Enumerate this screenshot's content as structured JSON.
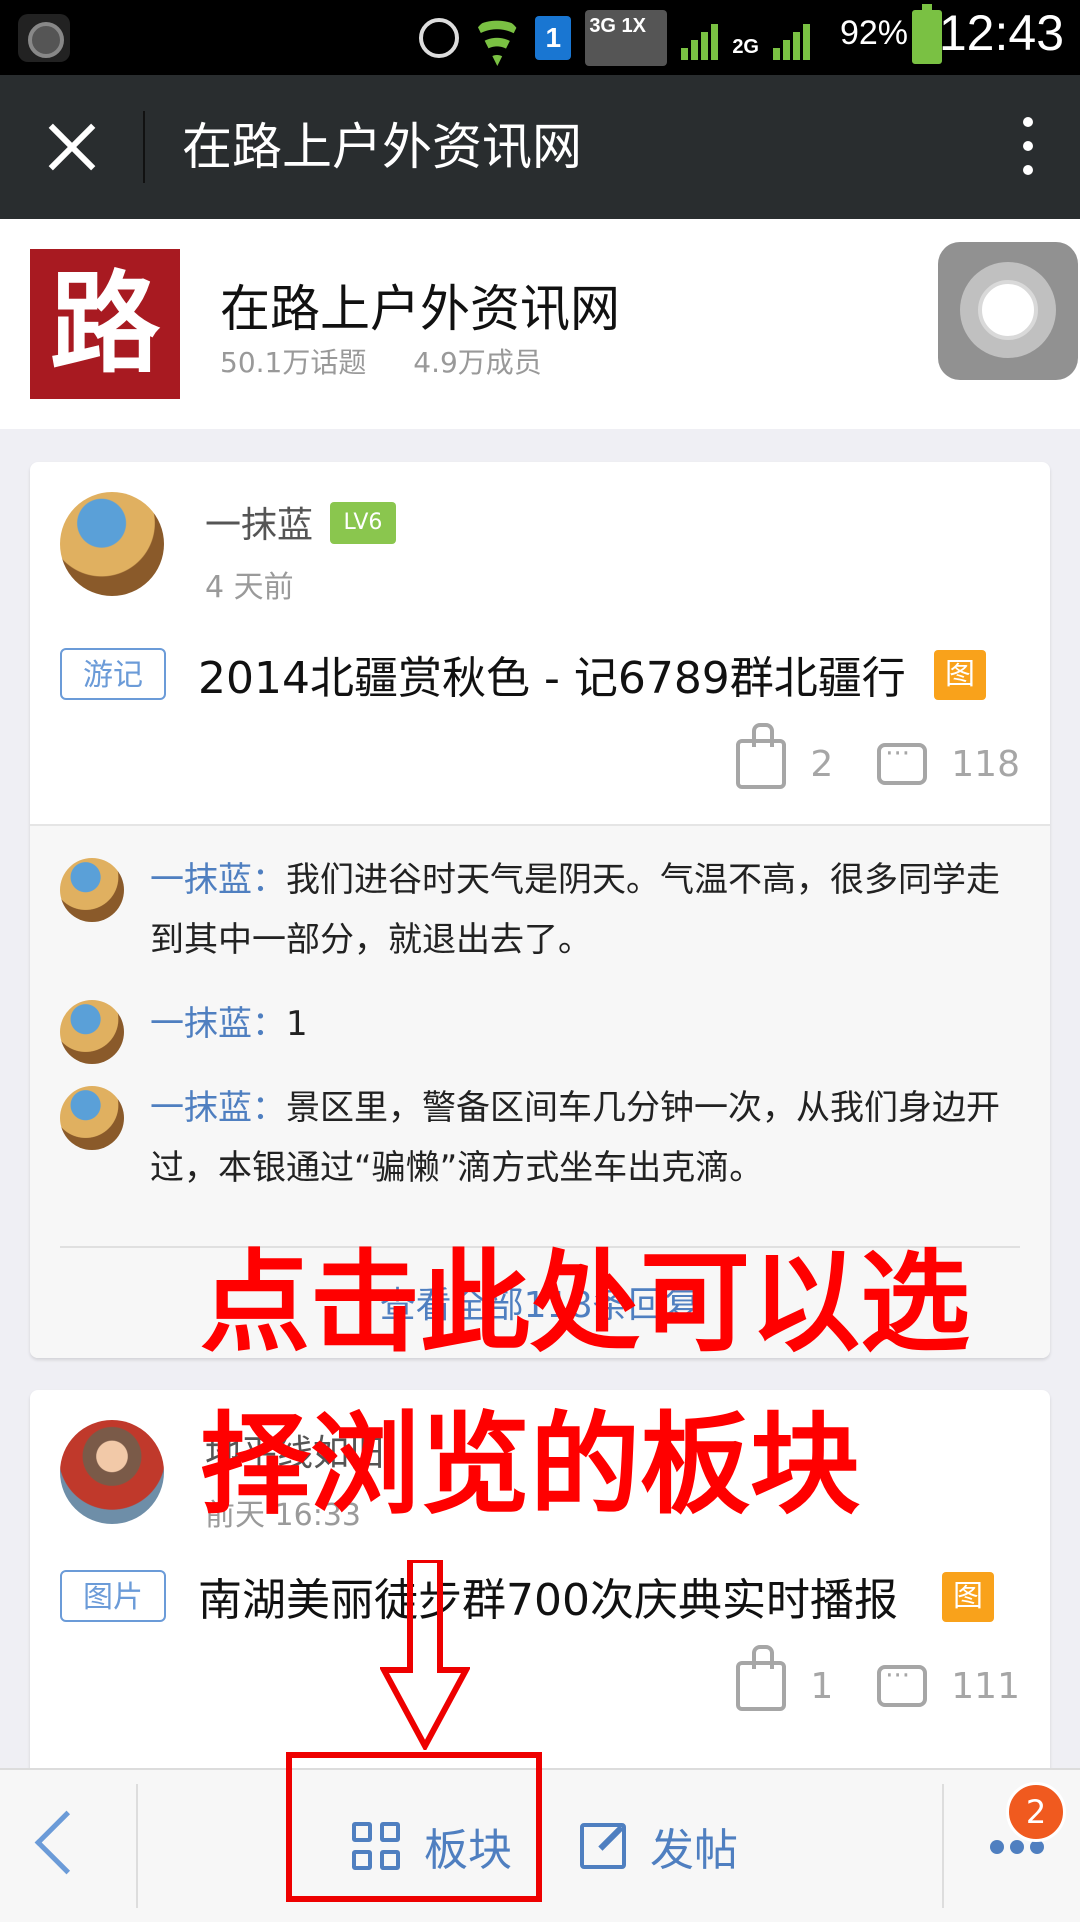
{
  "status_bar": {
    "network_sim": "1",
    "network_3g": "3G 1X",
    "network_2g": "2G",
    "battery": "92%",
    "time": "12:43"
  },
  "title_bar": {
    "title": "在路上户外资讯网"
  },
  "forum": {
    "name": "在路上户外资讯网",
    "topics": "50.1万话题",
    "members": "4.9万成员",
    "logo_char": "路"
  },
  "posts": [
    {
      "author": "一抹蓝",
      "level": "LV6",
      "time": "4 天前",
      "tag": "游记",
      "title": "2014北疆赏秋色 - 记6789群北疆行",
      "img_badge": "图",
      "likes": "2",
      "comments": "118",
      "replies": [
        {
          "name": "一抹蓝：",
          "text": "我们进谷时天气是阴天。气温不高，很多同学走到其中一部分，就退出去了。"
        },
        {
          "name": "一抹蓝：",
          "text": "1"
        },
        {
          "name": "一抹蓝：",
          "text": "景区里，警备区间车几分钟一次，从我们身边开过，本银通过“骗懒”滴方式坐车出克滴。"
        }
      ],
      "view_all": "查看全部118条回复"
    },
    {
      "author": "地平线如旧",
      "time": "前天 16:33",
      "tag": "图片",
      "title": "南湖美丽徒步群700次庆典实时播报",
      "img_badge": "图",
      "likes": "1",
      "comments": "111"
    }
  ],
  "annotation": {
    "line1": "点击此处可以选",
    "line2": "择浏览的板块"
  },
  "toolbar": {
    "sections_label": "板块",
    "post_label": "发帖",
    "more_badge": "2"
  },
  "colors": {
    "titlebar_bg": "#292d2f",
    "accent_blue": "#4f7fc0",
    "tag_blue": "#6b9bd8",
    "level_green": "#8ac64e",
    "badge_orange": "#f9a21b",
    "annotation_red": "#ff0000",
    "logo_red": "#a81a21"
  }
}
